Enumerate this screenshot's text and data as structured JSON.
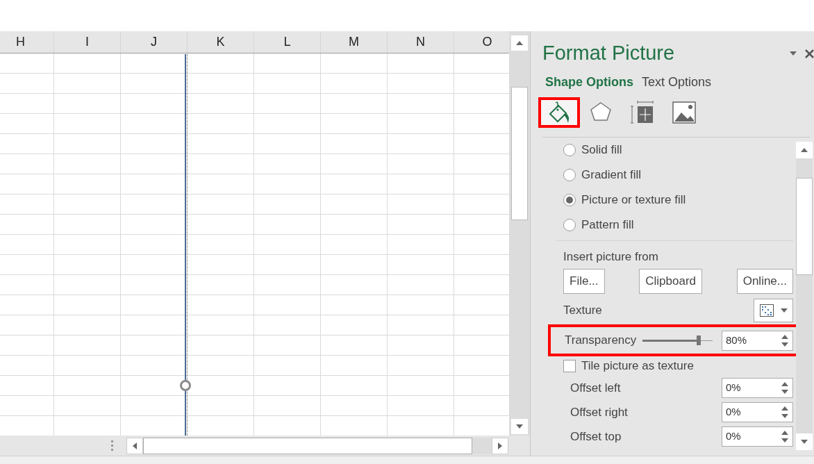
{
  "sheet": {
    "columns": [
      "H",
      "I",
      "J",
      "K",
      "L",
      "M",
      "N",
      "O"
    ]
  },
  "panel": {
    "title": "Format Picture",
    "tabs": [
      {
        "label": "Shape Options",
        "selected": true
      },
      {
        "label": "Text Options",
        "selected": false
      }
    ],
    "icon_tabs": [
      {
        "kind": "fill",
        "selected": true,
        "highlighted": true
      },
      {
        "kind": "effects",
        "selected": false,
        "highlighted": false
      },
      {
        "kind": "size",
        "selected": false,
        "highlighted": false
      },
      {
        "kind": "picture",
        "selected": false,
        "highlighted": false
      }
    ],
    "fill_options": [
      {
        "label": "Solid fill",
        "selected": false
      },
      {
        "label": "Gradient fill",
        "selected": false
      },
      {
        "label": "Picture or texture fill",
        "selected": true
      },
      {
        "label": "Pattern fill",
        "selected": false
      }
    ],
    "insert_label": "Insert picture from",
    "insert_buttons": [
      "File...",
      "Clipboard",
      "Online..."
    ],
    "texture_label": "Texture",
    "transparency": {
      "label": "Transparency",
      "level": 0.8,
      "value": "80%",
      "highlighted": true
    },
    "tile": {
      "label": "Tile picture as texture",
      "checked": false
    },
    "offsets": [
      {
        "label": "Offset left",
        "value": "0%"
      },
      {
        "label": "Offset right",
        "value": "0%"
      },
      {
        "label": "Offset top",
        "value": "0%"
      }
    ]
  }
}
